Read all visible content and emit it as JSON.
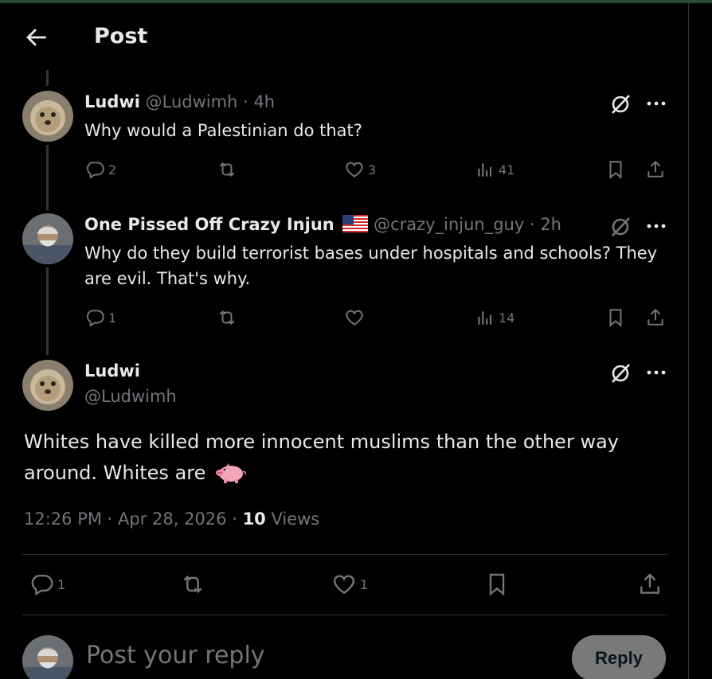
{
  "header": {
    "title": "Post"
  },
  "posts": [
    {
      "name": "Ludwi",
      "handle": "@Ludwimh",
      "time": "· 4h",
      "text": "Why would a Palestinian do that?",
      "replies": "2",
      "reposts": "",
      "likes": "3",
      "views": "41"
    },
    {
      "name": "One Pissed Off Crazy Injun",
      "flag": "us-flag-icon",
      "handle": "@crazy_injun_guy",
      "time": "· 2h",
      "text": "Why do they build terrorist bases under hospitals and schools? They are evil. That's why.",
      "replies": "1",
      "reposts": "",
      "likes": "",
      "views": "14"
    }
  ],
  "main_post": {
    "name": "Ludwi",
    "handle": "@Ludwimh",
    "text": "Whites have killed more innocent muslims than the other way around. Whites are",
    "emoji": "pig-icon",
    "timestamp": "12:26 PM · Apr 28, 2026 · ",
    "views_count": "10",
    "views_label": " Views",
    "replies": "1",
    "reposts": "",
    "likes": "1"
  },
  "reply_box": {
    "placeholder": "Post your reply",
    "button": "Reply"
  },
  "colors": {
    "background": "#000000",
    "text": "#e7e9ea",
    "muted": "#71767b",
    "reply_button": "#787a7a"
  }
}
